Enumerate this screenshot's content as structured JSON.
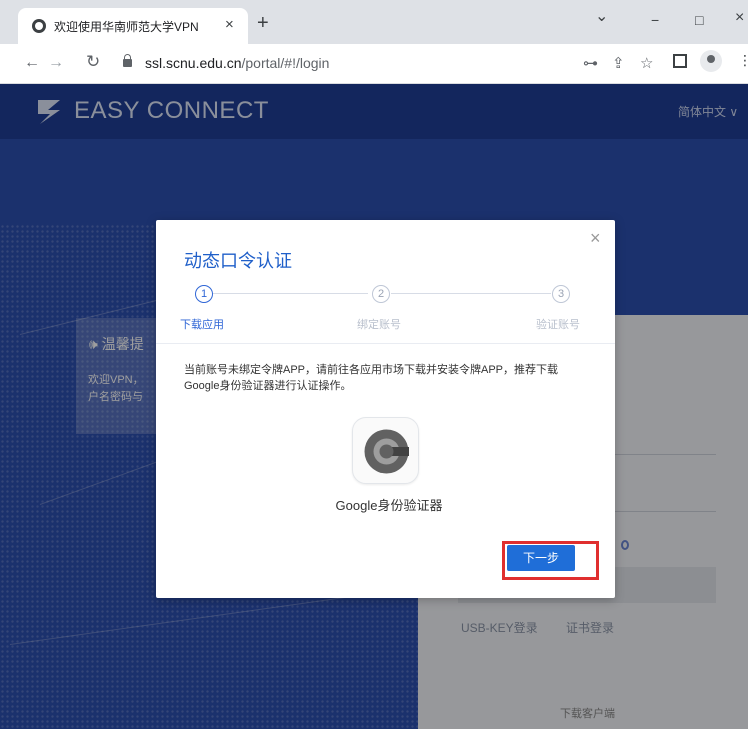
{
  "browser": {
    "tab_title": "欢迎使用华南师范大学VPN",
    "tab_close": "×",
    "new_tab": "+",
    "window_controls": {
      "tab_search": "⌄",
      "minimize": "−",
      "maximize": "□",
      "close": "×"
    },
    "nav": {
      "back": "←",
      "forward": "→",
      "reload": "↻"
    },
    "url_host": "ssl.scnu.edu.cn",
    "url_path": "/portal/#!/login",
    "toolbar_icons": {
      "key": "⊶",
      "share": "⇪",
      "star": "☆",
      "menu": "⋮"
    }
  },
  "page": {
    "logo": "EASY CONNECT",
    "language": "简体中文 ∨",
    "notice": {
      "title": "温馨提",
      "text": "欢迎VPN，\n户名密码与"
    },
    "login_panel": {
      "usb_key_login": "USB-KEY登录",
      "cert_login": "证书登录",
      "download_client": "下载客户端"
    }
  },
  "modal": {
    "title": "动态口令认证",
    "close": "×",
    "steps": [
      {
        "number": "1",
        "label": "下载应用"
      },
      {
        "number": "2",
        "label": "绑定账号"
      },
      {
        "number": "3",
        "label": "验证账号"
      }
    ],
    "message": "当前账号未绑定令牌APP，请前往各应用市场下载并安装令牌APP，推荐下载Google身份验证器进行认证操作。",
    "app_name": "Google身份验证器",
    "next_button": "下一步"
  },
  "colors": {
    "page_blue": "#2d4fb1",
    "header_blue": "#1f3e96",
    "accent": "#1f6ed8",
    "highlight": "#e02f2f"
  }
}
